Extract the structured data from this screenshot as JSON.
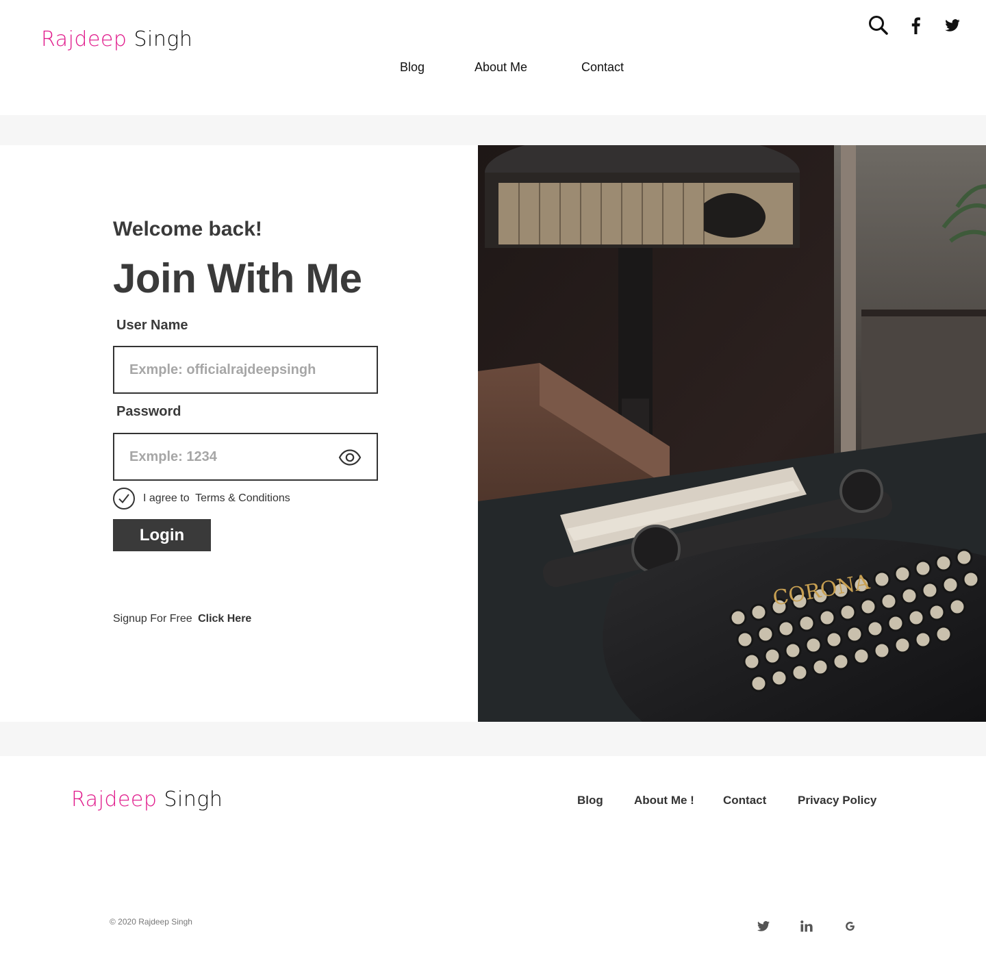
{
  "header": {
    "brand_first": "Rajdeep",
    "brand_last": "Singh",
    "nav": [
      "Blog",
      "About Me",
      "Contact"
    ],
    "icons": [
      "search-icon",
      "facebook-icon",
      "twitter-icon"
    ]
  },
  "login": {
    "welcome": "Welcome back!",
    "title": "Join With Me",
    "username_label": "User Name",
    "username_placeholder": "Exmple: officialrajdeepsingh",
    "password_label": "Password",
    "password_placeholder": "Exmple: 1234",
    "agree_prefix": "I agree to",
    "agree_terms": "Terms & Conditions",
    "button": "Login",
    "signup_text": "Signup For Free",
    "signup_link": "Click Here"
  },
  "photo": {
    "brand_text": "CORONA"
  },
  "footer": {
    "brand_first": "Rajdeep",
    "brand_last": "Singh",
    "nav": [
      "Blog",
      "About Me !",
      "Contact",
      "Privacy Policy"
    ],
    "copyright": "© 2020 Rajdeep Singh",
    "social": [
      "twitter-icon",
      "linkedin-icon",
      "google-icon"
    ]
  },
  "colors": {
    "accent": "#e0188a",
    "dark": "#3a3a3a",
    "band": "#f6f6f6"
  }
}
